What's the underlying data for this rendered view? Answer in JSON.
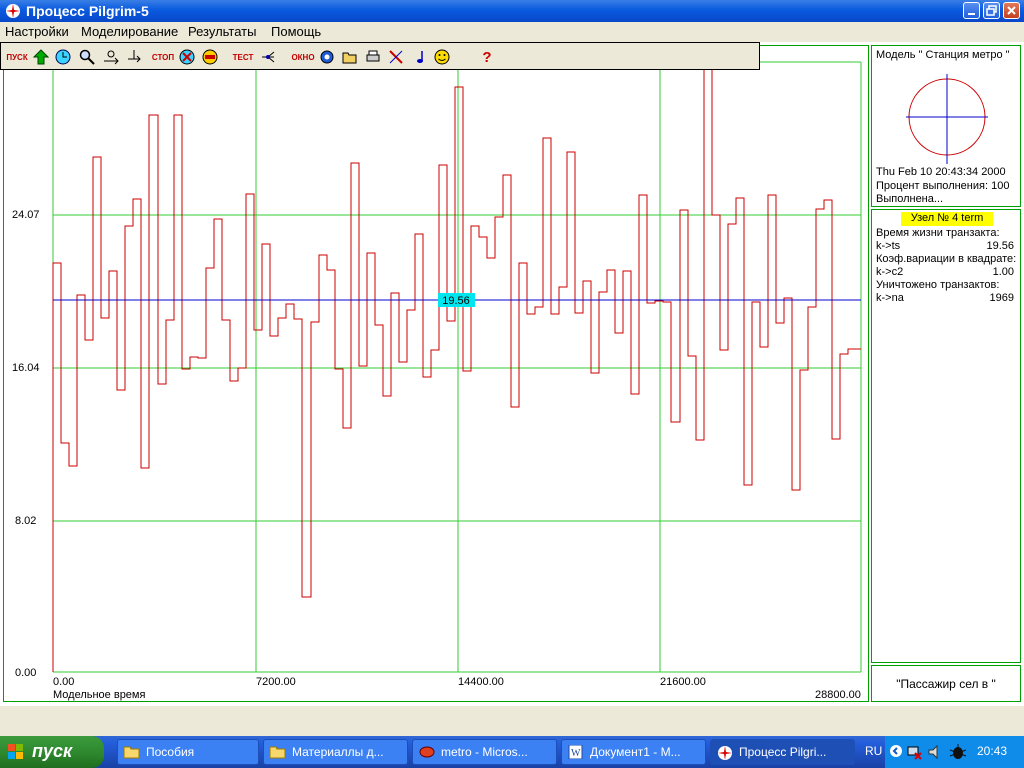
{
  "window": {
    "title": "Процесс Pilgrim-5"
  },
  "menu": [
    "Настройки",
    "Моделирование",
    "Результаты",
    "Помощь"
  ],
  "toolbar": {
    "start_label": "ПУСК",
    "stop_label": "СТОП",
    "test_label": "ТЕСТ",
    "window_label": "ОКНО",
    "help_label": "?"
  },
  "plot": {
    "y_ticks": [
      "24.07",
      "16.04",
      "8.02",
      "0.00"
    ],
    "x_ticks": [
      "0.00",
      "7200.00",
      "14400.00",
      "21600.00",
      "28800.00"
    ],
    "xlabel": "Модельное время",
    "mean_label": "19.56"
  },
  "model_panel": {
    "title": "Модель \" Станция метро \"",
    "date": "Thu Feb 10 20:43:34 2000",
    "progress": "Процент выполнения: 100",
    "status": "Выполнена..."
  },
  "node_panel": {
    "header": "Узел № 4 term",
    "rows": [
      {
        "label": "Время жизни транзакта:",
        "key": "",
        "value": ""
      },
      {
        "label": "",
        "key": "k->ts",
        "value": "19.56"
      },
      {
        "label": "Коэф.вариации в квадрате:",
        "key": "",
        "value": ""
      },
      {
        "label": "",
        "key": "k->c2",
        "value": "1.00"
      },
      {
        "label": "Уничтожено транзактов:",
        "key": "",
        "value": ""
      },
      {
        "label": "",
        "key": "k->na",
        "value": "1969"
      }
    ]
  },
  "status_panel": {
    "text": "\"Пассажир сел в \""
  },
  "taskbar": {
    "start": "пуск",
    "tasks": [
      "Пособия",
      "Материаллы д...",
      "metro - Micros...",
      "Документ1 - М...",
      "Процесс Pilgri..."
    ],
    "lang": "RU",
    "time": "20:43"
  }
}
